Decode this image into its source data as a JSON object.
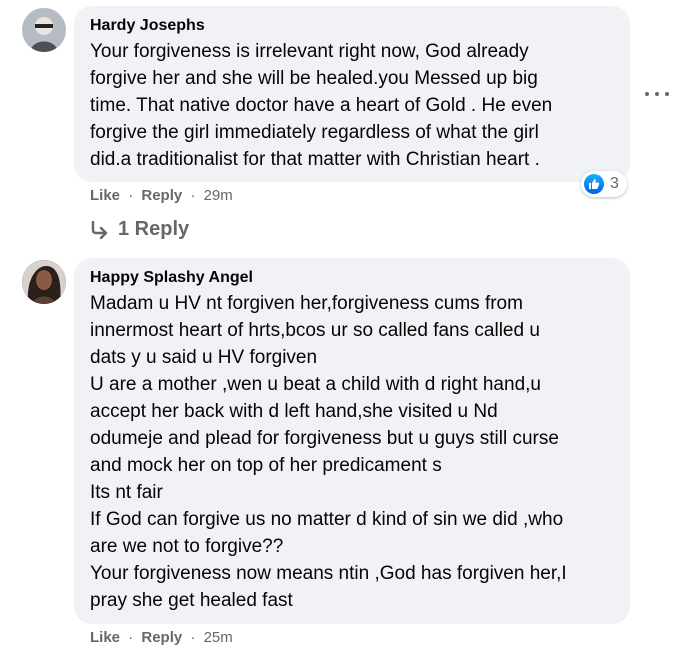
{
  "comments": [
    {
      "author": "Hardy Josephs",
      "text": "Your forgiveness is irrelevant right now, God already\nforgive her and she will be healed.you Messed up big\ntime. That native doctor have a heart of Gold . He even\nforgive the girl immediately regardless of what the girl\ndid.a traditionalist for that matter with Christian heart .",
      "actions": {
        "like": "Like",
        "reply": "Reply",
        "time": "29m",
        "sep": "·"
      },
      "reaction_count": "3",
      "replies_label": "1 Reply"
    },
    {
      "author": "Happy Splashy Angel",
      "text": "Madam u HV nt forgiven her,forgiveness cums from\ninnermost heart of hrts,bcos ur so called fans called u\ndats y u said u HV forgiven\nU are a mother ,wen u beat a child with d right hand,u\naccept her back with d left hand,she visited u Nd\nodumeje and plead for forgiveness but u guys still curse\nand mock her on top of her predicament s\nIts nt fair\nIf God can forgive us no matter d kind of sin we did ,who\nare we not to forgive??\nYour forgiveness now means ntin ,God has forgiven her,I\npray she get healed fast",
      "actions": {
        "like": "Like",
        "reply": "Reply",
        "time": "25m",
        "sep": "·"
      }
    }
  ],
  "colors": {
    "bubble_bg": "#f0f2f5",
    "meta_text": "#65676b",
    "like_blue": "#0866ff"
  },
  "icons": {
    "reaction": "like-reaction-icon",
    "reply_arrow": "reply-arrow-icon",
    "more": "more-options-icon"
  }
}
